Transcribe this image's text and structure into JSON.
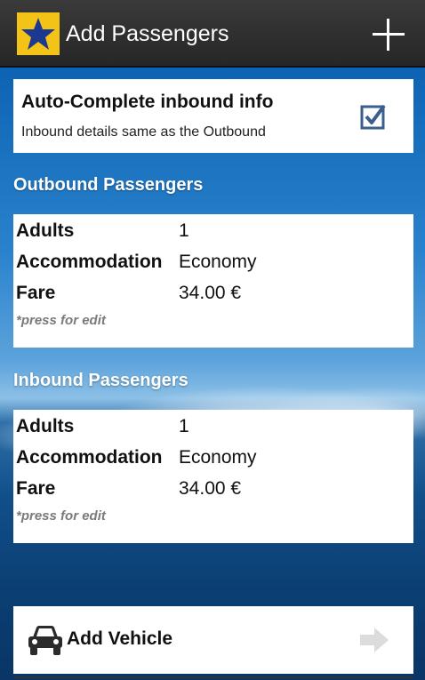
{
  "action_bar": {
    "title": "Add Passengers",
    "logo_icon": "star-logo-icon",
    "add_icon": "plus-icon",
    "logo_color": "#f3c318",
    "star_color": "#1b3a8f"
  },
  "auto_complete": {
    "title": "Auto-Complete inbound info",
    "subtitle": "Inbound details same as the Outbound",
    "checked": true
  },
  "outbound": {
    "header": "Outbound Passengers",
    "rows": [
      {
        "label": "Adults",
        "value": "1"
      },
      {
        "label": "Accommodation",
        "value": "Economy"
      },
      {
        "label": "Fare",
        "value": "34.00 €"
      }
    ],
    "hint": "*press for edit"
  },
  "inbound": {
    "header": "Inbound Passengers",
    "rows": [
      {
        "label": "Adults",
        "value": "1"
      },
      {
        "label": "Accommodation",
        "value": "Economy"
      },
      {
        "label": "Fare",
        "value": "34.00 €"
      }
    ],
    "hint": "*press for edit"
  },
  "vehicle": {
    "label": "Add Vehicle",
    "icon": "car-icon",
    "arrow_icon": "arrow-right-icon"
  }
}
